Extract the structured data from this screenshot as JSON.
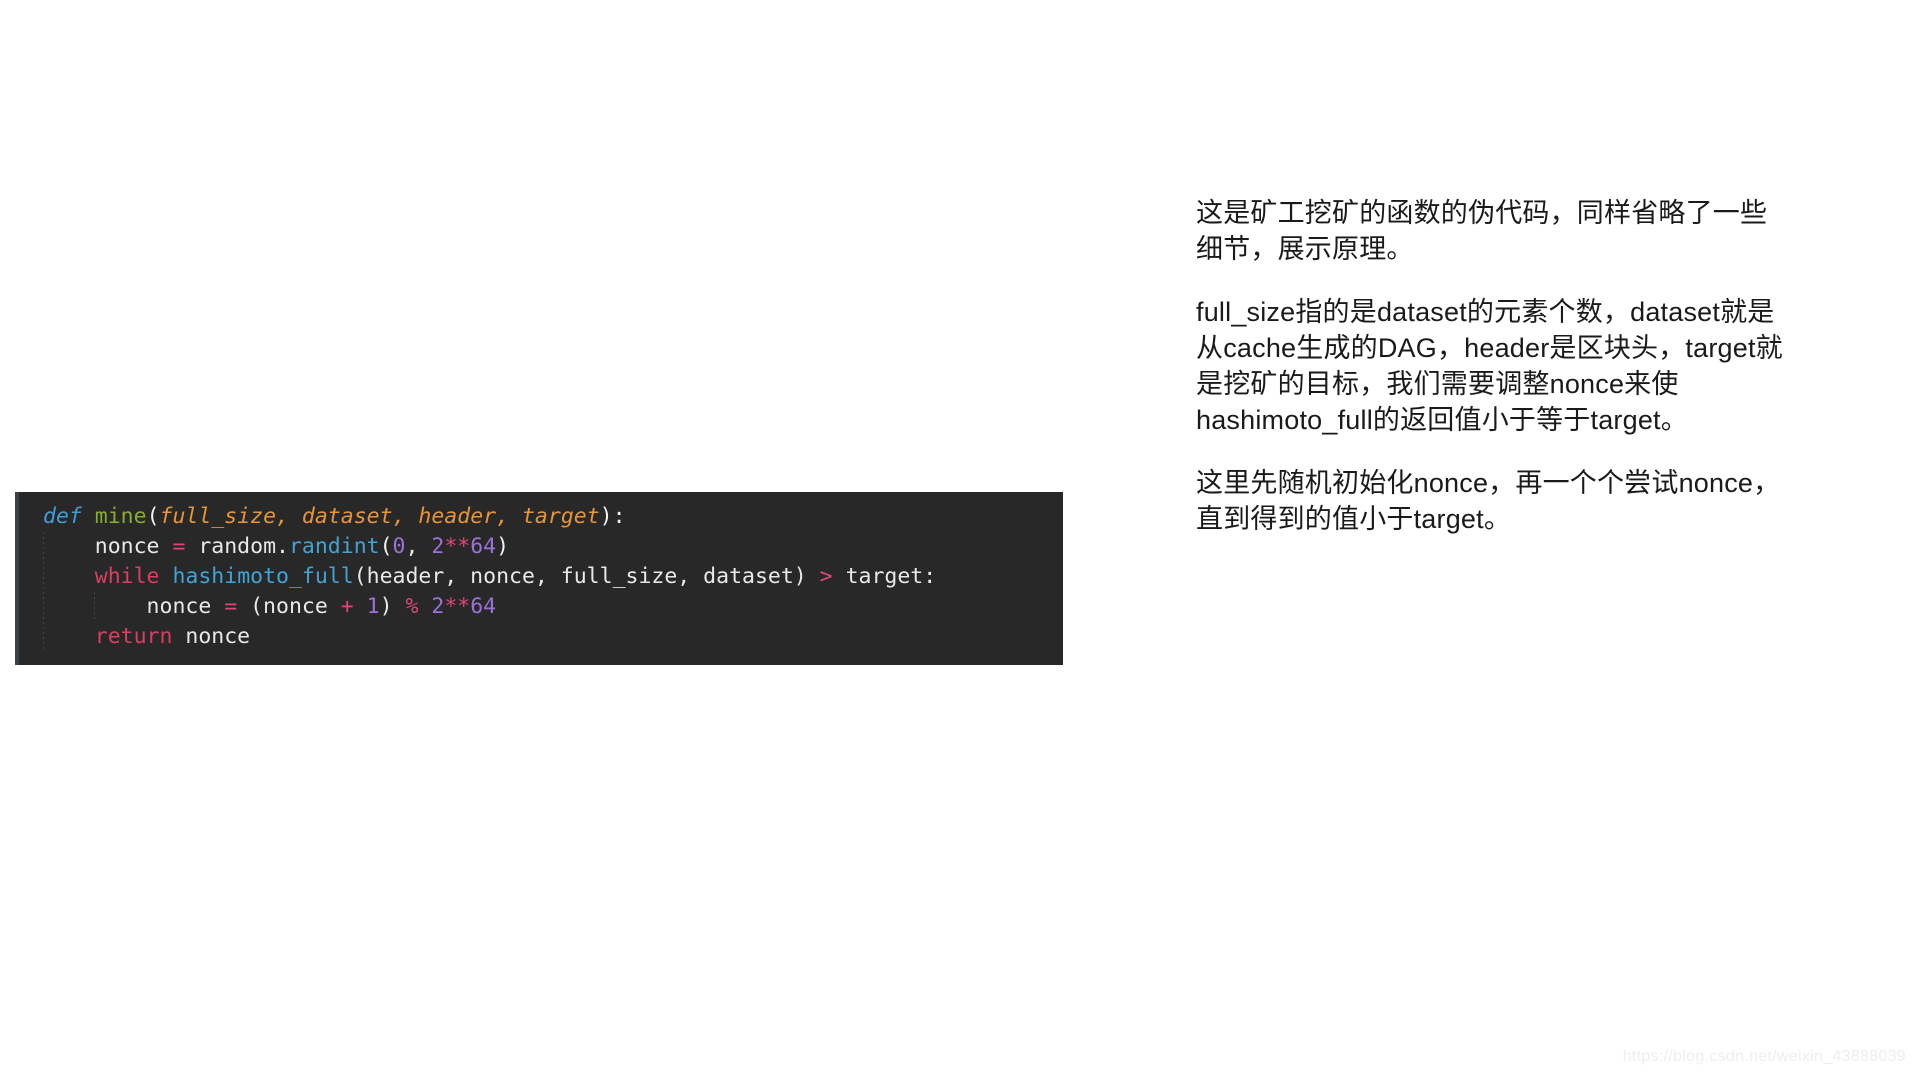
{
  "code_block": {
    "language": "python",
    "background_color": "#282828",
    "lines": [
      {
        "tokens": [
          {
            "text": "def",
            "style": "kw"
          },
          {
            "text": " ",
            "style": "plain"
          },
          {
            "text": "mine",
            "style": "fnname"
          },
          {
            "text": "(",
            "style": "paren"
          },
          {
            "text": "full_size",
            "style": "param"
          },
          {
            "text": ", ",
            "style": "param"
          },
          {
            "text": "dataset",
            "style": "param"
          },
          {
            "text": ", ",
            "style": "param"
          },
          {
            "text": "header",
            "style": "param"
          },
          {
            "text": ", ",
            "style": "param"
          },
          {
            "text": "target",
            "style": "param"
          },
          {
            "text": "):",
            "style": "paren"
          }
        ]
      },
      {
        "tokens": [
          {
            "text": "    nonce ",
            "style": "plain"
          },
          {
            "text": "=",
            "style": "op"
          },
          {
            "text": " random",
            "style": "plain"
          },
          {
            "text": ".",
            "style": "plain"
          },
          {
            "text": "randint",
            "style": "call"
          },
          {
            "text": "(",
            "style": "paren"
          },
          {
            "text": "0",
            "style": "num"
          },
          {
            "text": ", ",
            "style": "plain"
          },
          {
            "text": "2",
            "style": "num"
          },
          {
            "text": "**",
            "style": "op"
          },
          {
            "text": "64",
            "style": "num"
          },
          {
            "text": ")",
            "style": "paren"
          }
        ]
      },
      {
        "tokens": [
          {
            "text": "    ",
            "style": "plain"
          },
          {
            "text": "while",
            "style": "kw2"
          },
          {
            "text": " ",
            "style": "plain"
          },
          {
            "text": "hashimoto_full",
            "style": "call"
          },
          {
            "text": "(header, nonce, full_size, dataset)",
            "style": "plain"
          },
          {
            "text": " > ",
            "style": "op"
          },
          {
            "text": "target:",
            "style": "plain"
          }
        ]
      },
      {
        "tokens": [
          {
            "text": "        nonce ",
            "style": "plain"
          },
          {
            "text": "=",
            "style": "op"
          },
          {
            "text": " (nonce ",
            "style": "plain"
          },
          {
            "text": "+",
            "style": "op"
          },
          {
            "text": " ",
            "style": "plain"
          },
          {
            "text": "1",
            "style": "num"
          },
          {
            "text": ") ",
            "style": "plain"
          },
          {
            "text": "%",
            "style": "op"
          },
          {
            "text": " ",
            "style": "plain"
          },
          {
            "text": "2",
            "style": "num"
          },
          {
            "text": "**",
            "style": "op"
          },
          {
            "text": "64",
            "style": "num"
          }
        ]
      },
      {
        "tokens": [
          {
            "text": "    ",
            "style": "plain"
          },
          {
            "text": "return",
            "style": "kw2"
          },
          {
            "text": " nonce",
            "style": "plain"
          }
        ]
      }
    ],
    "plain_text": "def mine(full_size, dataset, header, target):\n    nonce = random.randint(0, 2**64)\n    while hashimoto_full(header, nonce, full_size, dataset) > target:\n        nonce = (nonce + 1) % 2**64\n    return nonce"
  },
  "text_column": {
    "paragraphs": [
      "这是矿工挖矿的函数的伪代码，同样省略了一些细节，展示原理。",
      "full_size指的是dataset的元素个数，dataset就是从cache生成的DAG，header是区块头，target就是挖矿的目标，我们需要调整nonce来使hashimoto_full的返回值小于等于target。",
      "这里先随机初始化nonce，再一个个尝试nonce，直到得到的值小于target。"
    ]
  },
  "watermark": {
    "text": "https://blog.csdn.net/weixin_43888039"
  }
}
